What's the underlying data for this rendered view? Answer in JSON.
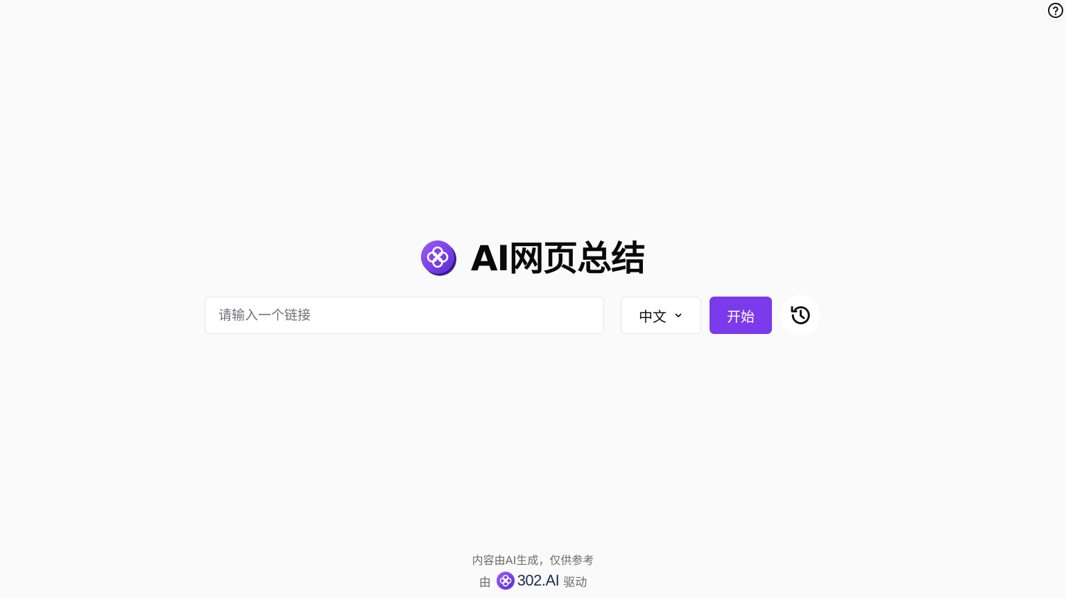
{
  "app": {
    "title": "AI网页总结",
    "accent_color": "#7c3aed"
  },
  "header": {
    "help_icon": "question-circle-icon"
  },
  "search": {
    "placeholder": "请输入一个链接",
    "value": ""
  },
  "language": {
    "selected": "中文",
    "icon": "chevron-down-icon"
  },
  "actions": {
    "start_label": "开始",
    "history_icon": "history-icon"
  },
  "footer": {
    "disclaimer": "内容由AI生成，仅供参考",
    "powered_prefix": "由",
    "brand": "302.AI",
    "powered_suffix": "驱动"
  }
}
